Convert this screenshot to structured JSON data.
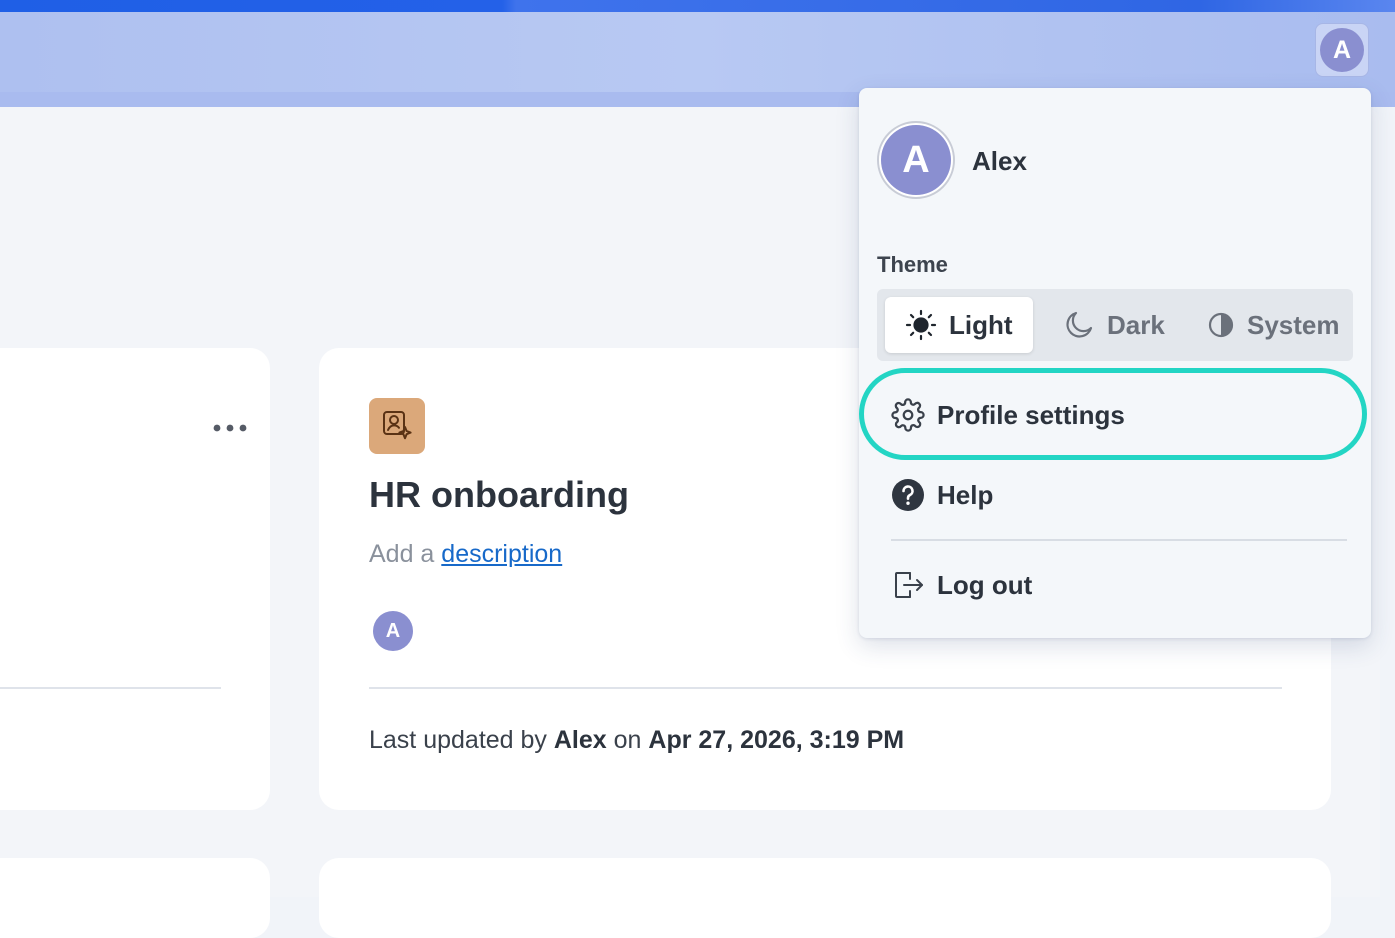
{
  "header": {
    "avatar_initial": "A"
  },
  "card_left": {
    "more_icon": "more-horizontal-icon"
  },
  "card": {
    "icon": "user-sparkle-icon",
    "icon_color": "#dba87a",
    "title": "HR onboarding",
    "description_prefix": "Add a",
    "description_link": "description",
    "member_initial": "A",
    "last_updated_prefix": "Last updated by",
    "last_updated_user": "Alex",
    "last_updated_on": "on",
    "last_updated_time": "Apr 27, 2026, 3:19 PM"
  },
  "dropdown": {
    "avatar_initial": "A",
    "username": "Alex",
    "theme_label": "Theme",
    "theme_options": [
      {
        "label": "Light",
        "icon": "sun-icon",
        "active": true
      },
      {
        "label": "Dark",
        "icon": "moon-icon",
        "active": false
      },
      {
        "label": "System",
        "icon": "contrast-icon",
        "active": false
      }
    ],
    "menu": [
      {
        "label": "Profile settings",
        "icon": "gear-icon",
        "highlighted": true
      },
      {
        "label": "Help",
        "icon": "help-icon",
        "highlighted": false
      },
      {
        "label": "Log out",
        "icon": "logout-icon",
        "highlighted": false
      }
    ]
  },
  "colors": {
    "accent": "#23d5c4",
    "avatar": "#8a8fd0",
    "link": "#1769c9"
  }
}
